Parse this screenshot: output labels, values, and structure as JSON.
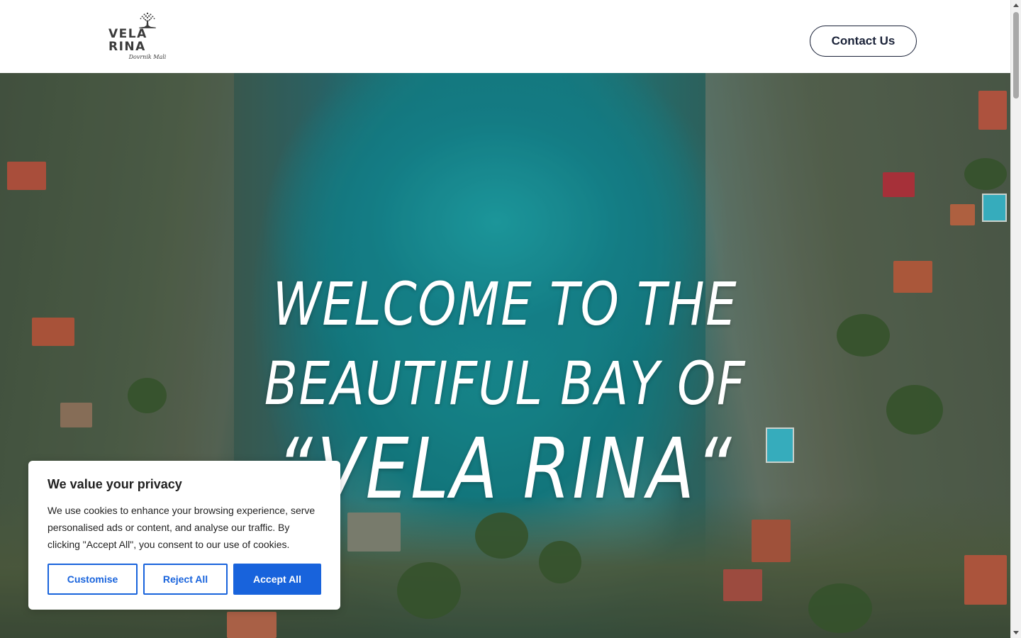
{
  "header": {
    "logo": {
      "name": "VELA RINA",
      "subtitle": "Dovrnik Mali",
      "icon": "tree-icon"
    },
    "contact_label": "Contact Us"
  },
  "hero": {
    "title_line1": "WELCOME TO THE",
    "title_line2": "BEAUTIFUL BAY OF",
    "title_line3": "“VELA RINA“",
    "background": "aerial-bay-photo"
  },
  "cookie_banner": {
    "title": "We value your privacy",
    "text": "We use cookies to enhance your browsing experience, serve personalised ads or content, and analyse our traffic. By clicking \"Accept All\", you consent to our use of cookies.",
    "customise_label": "Customise",
    "reject_label": "Reject All",
    "accept_label": "Accept All",
    "accent_color": "#1863dc"
  },
  "scrollbar": {
    "position_percent": 0
  }
}
